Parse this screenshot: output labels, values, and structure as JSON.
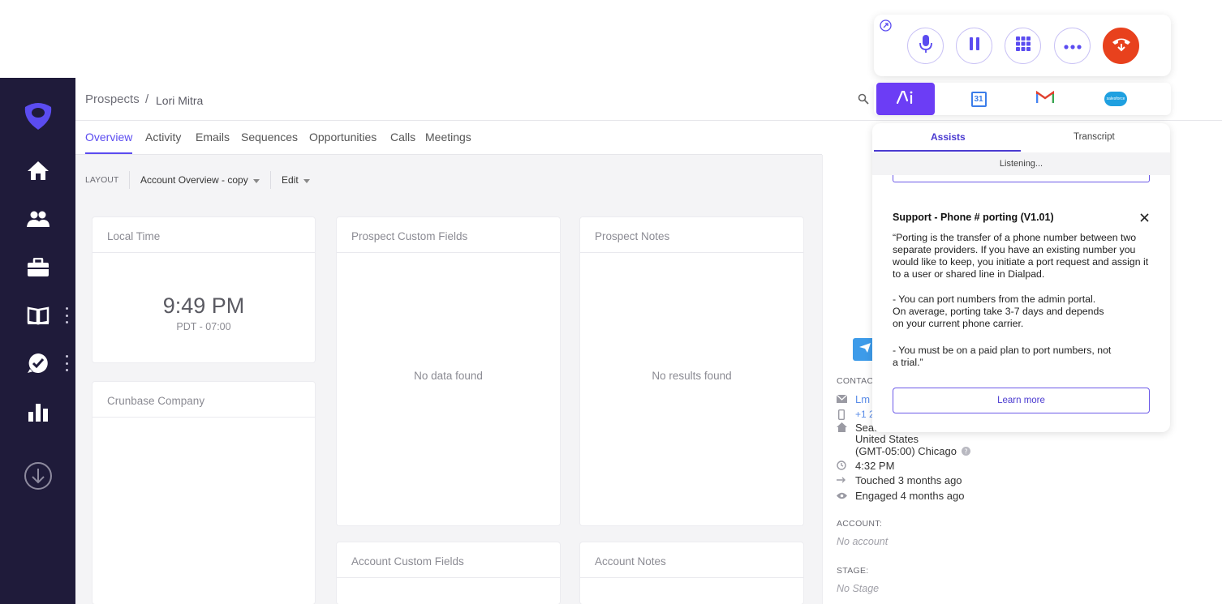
{
  "nav": {
    "items": [
      "home-icon",
      "people-icon",
      "briefcase-icon",
      "book-icon",
      "check-bubble-icon",
      "bar-chart-icon",
      "download-icon"
    ]
  },
  "breadcrumb": {
    "root": "Prospects",
    "separator": "/",
    "current": "Lori Mitra"
  },
  "tabs": [
    "Overview",
    "Activity",
    "Emails",
    "Sequences",
    "Opportunities",
    "Calls",
    "Meetings"
  ],
  "layout_bar": {
    "label": "LAYOUT",
    "layout_value": "Account Overview - copy",
    "edit": "Edit"
  },
  "cards": {
    "local_time": {
      "title": "Local Time",
      "time": "9:49 PM",
      "zone": "PDT - 07:00"
    },
    "crunbase": {
      "title": "Crunbase Company"
    },
    "prospect_custom": {
      "title": "Prospect Custom Fields",
      "empty": "No data found"
    },
    "prospect_notes": {
      "title": "Prospect Notes",
      "empty": "No results found"
    },
    "account_custom": {
      "title": "Account Custom Fields"
    },
    "account_notes": {
      "title": "Account Notes"
    }
  },
  "contact": {
    "label": "CONTACT",
    "email": "Lm",
    "phone": "+1 2",
    "address_line1": "Seat",
    "address_line2": "United States",
    "address_line3": "(GMT-05:00) Chicago",
    "local_time": "4:32 PM",
    "touched": "Touched 3 months ago",
    "engaged": "Engaged 4 months ago"
  },
  "account": {
    "label": "ACCOUNT:",
    "value": "No account"
  },
  "stage": {
    "label": "STAGE:",
    "value": "No Stage"
  },
  "dialpad": {
    "apps": [
      "ai-icon",
      "calendar-31-icon",
      "gmail-icon",
      "salesforce-icon"
    ],
    "calendar_day": "31",
    "salesforce_text": "salesforce",
    "assist_tab": "Assists",
    "transcript_tab": "Transcript",
    "status": "Listening...",
    "card_title": "Support - Phone # porting (V1.01)",
    "para1": "“Porting is the transfer of a phone number between two separate providers. If you have an existing number you would like to keep, you initiate a port request and assign it to a user or shared line in Dialpad.",
    "para2_line1": "- You can port numbers from the admin portal.",
    "para2_line2": "On average, porting take 3-7 days and depends",
    "para2_line3": "on your current phone carrier.",
    "para3_line1": "- You must be on a paid plan to port numbers, not",
    "para3_line2": "a trial.”",
    "learn_more": "Learn more"
  },
  "colors": {
    "accent": "#5b4cf0",
    "nav_bg": "#1f1b3a",
    "hangup": "#e8411d"
  }
}
